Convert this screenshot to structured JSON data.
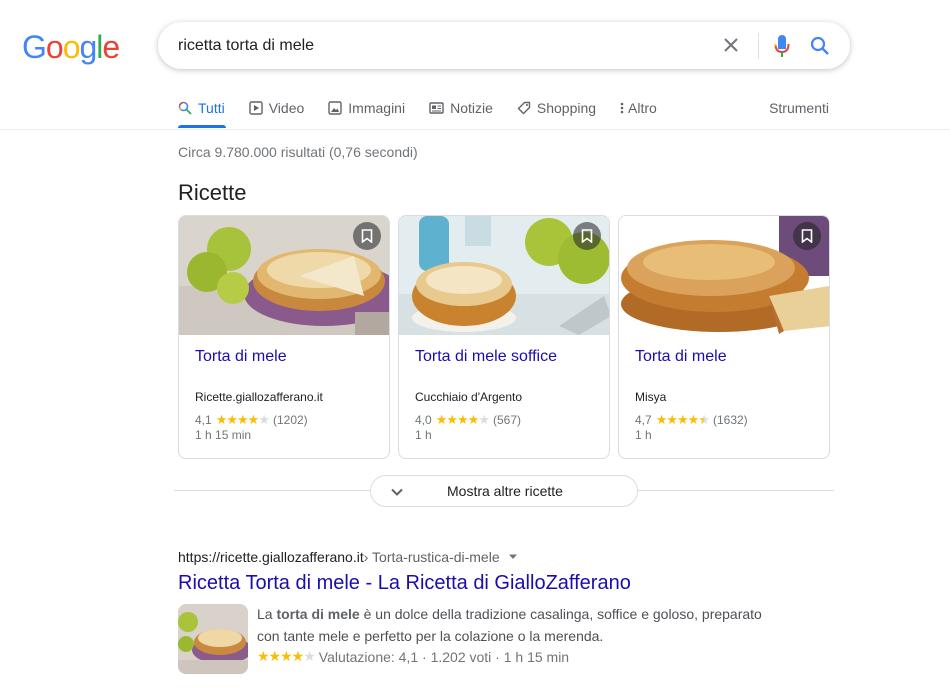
{
  "logo": {
    "letters": [
      "G",
      "o",
      "o",
      "g",
      "l",
      "e"
    ],
    "colors": [
      "#4285f4",
      "#ea4335",
      "#fbbc05",
      "#4285f4",
      "#34a853",
      "#ea4335"
    ]
  },
  "search": {
    "value": "ricetta torta di mele"
  },
  "tabs": [
    {
      "label": "Tutti",
      "icon": "search-icon",
      "active": true
    },
    {
      "label": "Video",
      "icon": "video-icon"
    },
    {
      "label": "Immagini",
      "icon": "image-icon"
    },
    {
      "label": "Notizie",
      "icon": "news-icon"
    },
    {
      "label": "Shopping",
      "icon": "tag-icon"
    },
    {
      "label": "Altro",
      "icon": "more-vert-icon"
    }
  ],
  "tools_label": "Strumenti",
  "result_stats": "Circa 9.780.000 risultati (0,76 secondi)",
  "recipes": {
    "title": "Ricette",
    "cards": [
      {
        "title": "Torta di mele",
        "source": "Ricette.giallozafferano.it",
        "rating": "4,1",
        "stars": 4,
        "count": "(1202)",
        "time": "1 h 15 min"
      },
      {
        "title": "Torta di mele soffice",
        "source": "Cucchiaio d'Argento",
        "rating": "4,0",
        "stars": 4,
        "count": "(567)",
        "time": "1 h"
      },
      {
        "title": "Torta di mele",
        "source": "Misya",
        "rating": "4,7",
        "stars": 4.5,
        "count": "(1632)",
        "time": "1 h"
      }
    ],
    "more_label": "Mostra altre ricette"
  },
  "result": {
    "url": "https://ricette.giallozafferano.it",
    "breadcrumb": " › Torta-rustica-di-mele",
    "title": "Ricetta Torta di mele - La Ricetta di GialloZafferano",
    "snippet_pre": "La ",
    "snippet_bold": "torta di mele",
    "snippet_post": " è un dolce della tradizione casalinga, soffice e goloso, preparato con tante mele e perfetto per la colazione o la merenda.",
    "rating_text": "Valutazione: 4,1 · 1.202 voti · 1 h 15 min"
  }
}
